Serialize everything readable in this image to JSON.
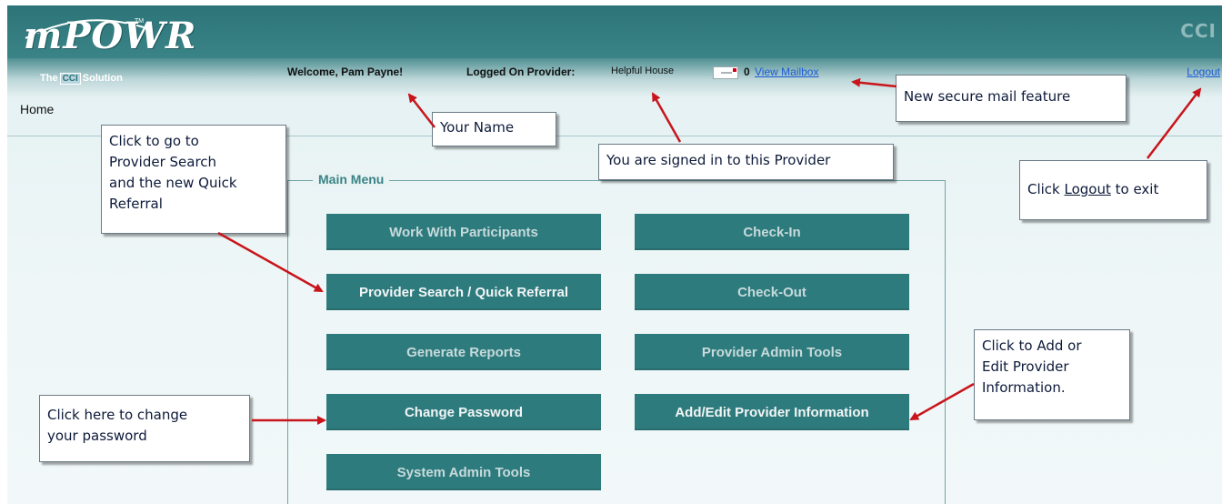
{
  "app": {
    "logo_text": "mPOWR",
    "logo_tm": "TM",
    "logo_sub_left": "The",
    "logo_sub_box": "CCI",
    "logo_sub_right": "Solution",
    "brand_right": "CCI"
  },
  "header": {
    "welcome": "Welcome, Pam Payne!",
    "provider_label": "Logged On Provider:",
    "provider_name": "Helpful House",
    "mail_count": "0",
    "mail_link": "View Mailbox",
    "logout": "Logout"
  },
  "breadcrumb": {
    "home": "Home"
  },
  "main_menu": {
    "legend": "Main Menu",
    "buttons": [
      "Work With Participants",
      "Check-In",
      "Provider Search / Quick Referral",
      "Check-Out",
      "Generate Reports",
      "Provider Admin Tools",
      "Change Password",
      "Add/Edit Provider Information",
      "System Admin Tools"
    ]
  },
  "callouts": {
    "provider_search": [
      "Click to go to",
      "Provider Search",
      "and the new Quick",
      "Referral"
    ],
    "your_name": "Your Name",
    "signed_in": "You are signed in to this Provider",
    "secure_mail": "New secure mail feature",
    "logout_prefix": "Click ",
    "logout_link": "Logout",
    "logout_suffix": " to exit",
    "add_edit": [
      "Click to Add or",
      "Edit Provider",
      "Information."
    ],
    "change_password": [
      "Click here to change",
      "your password"
    ]
  },
  "colors": {
    "header_teal": "#2c7478",
    "button_teal": "#2e7b7e",
    "arrow_red": "#c8151b",
    "link_blue": "#1a5bd6"
  }
}
